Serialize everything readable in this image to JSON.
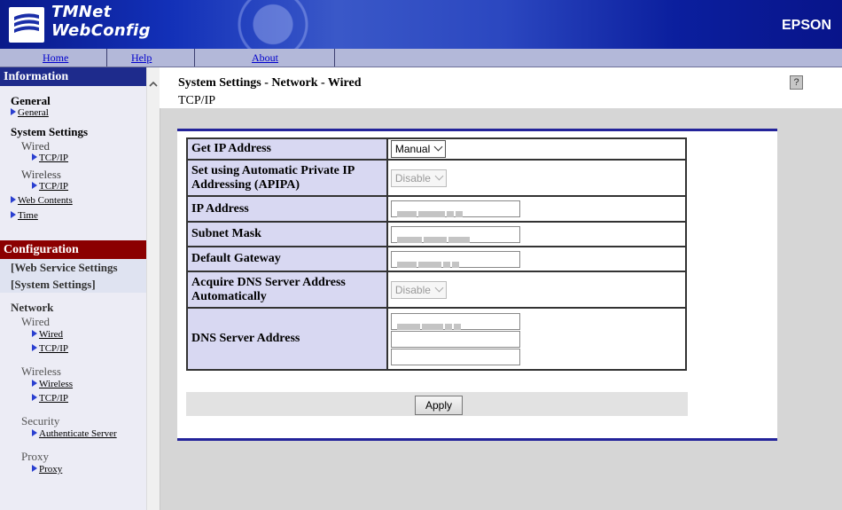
{
  "header": {
    "brand_line1": "TMNet",
    "brand_line2": "WebConfig",
    "vendor": "EPSON"
  },
  "nav": {
    "home": "Home",
    "help": "Help",
    "about": "About"
  },
  "sidebar": {
    "information": "Information",
    "general_heading": "General",
    "general_link": "General",
    "system_settings_heading": "System Settings",
    "wired_label": "Wired",
    "wired_tcpip": "TCP/IP",
    "wireless_label": "Wireless",
    "wireless_tcpip": "TCP/IP",
    "web_contents": "Web Contents",
    "time": "Time",
    "configuration": "Configuration",
    "web_service_settings": "[Web Service Settings",
    "system_settings_bracket": "[System Settings]",
    "network_heading": "Network",
    "net_wired_label": "Wired",
    "net_wired_link": "Wired",
    "net_wired_tcpip": "TCP/IP",
    "net_wireless_label": "Wireless",
    "net_wireless_link": "Wireless",
    "net_wireless_tcpip": "TCP/IP",
    "security_label": "Security",
    "authenticate_server": "Authenticate Server",
    "proxy_label": "Proxy",
    "proxy_link": "Proxy"
  },
  "main": {
    "title": "System Settings - Network - Wired",
    "subtitle": "TCP/IP",
    "help_glyph": "?",
    "form": {
      "get_ip_label": "Get IP Address",
      "get_ip_value": "Manual",
      "apipa_label": "Set using Automatic Private IP Addressing (APIPA)",
      "apipa_value": "Disable",
      "ip_label": "IP Address",
      "subnet_label": "Subnet Mask",
      "gateway_label": "Default Gateway",
      "dns_auto_label": "Acquire DNS Server Address Automatically",
      "dns_auto_value": "Disable",
      "dns_label": "DNS Server Address"
    },
    "apply": "Apply"
  },
  "colors": {
    "banner": "#1230b8",
    "info_bar": "#1e2b8c",
    "config_bar": "#8b0000",
    "label_cell": "#d8d8f2",
    "panel_rule": "#23239a"
  }
}
